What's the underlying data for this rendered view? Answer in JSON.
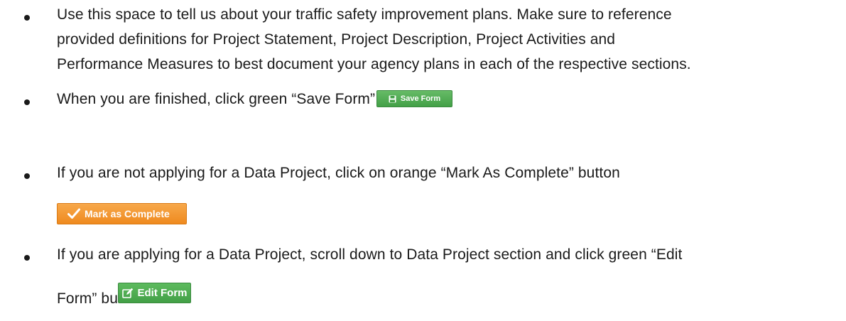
{
  "bullets": {
    "b1_line1": "Use this space to tell us about your traffic safety improvement plans.  Make sure to reference",
    "b1_line2": "provided definitions for Project Statement, Project Description, Project Activities and",
    "b1_line3": "Performance Measures to best document your agency plans in each of the respective sections.",
    "b2_line1": "When you are finished, click green “Save Form” button",
    "b3_line1": "If you are not applying for a Data Project, click on orange “Mark As Complete” button",
    "b4_line1": "If you are applying for a Data Project, scroll down to Data Project section and click green “Edit",
    "b4_line2": "Form” button"
  },
  "buttons": {
    "save_label": "Save Form",
    "save_icon": "floppy-disk-icon",
    "complete_label": "Mark as Complete",
    "complete_icon": "checkmark-icon",
    "edit_label": "Edit Form",
    "edit_icon": "edit-pencil-icon"
  },
  "colors": {
    "save_green": "#43a047",
    "complete_orange": "#ef8a1f",
    "edit_green": "#43a047"
  }
}
